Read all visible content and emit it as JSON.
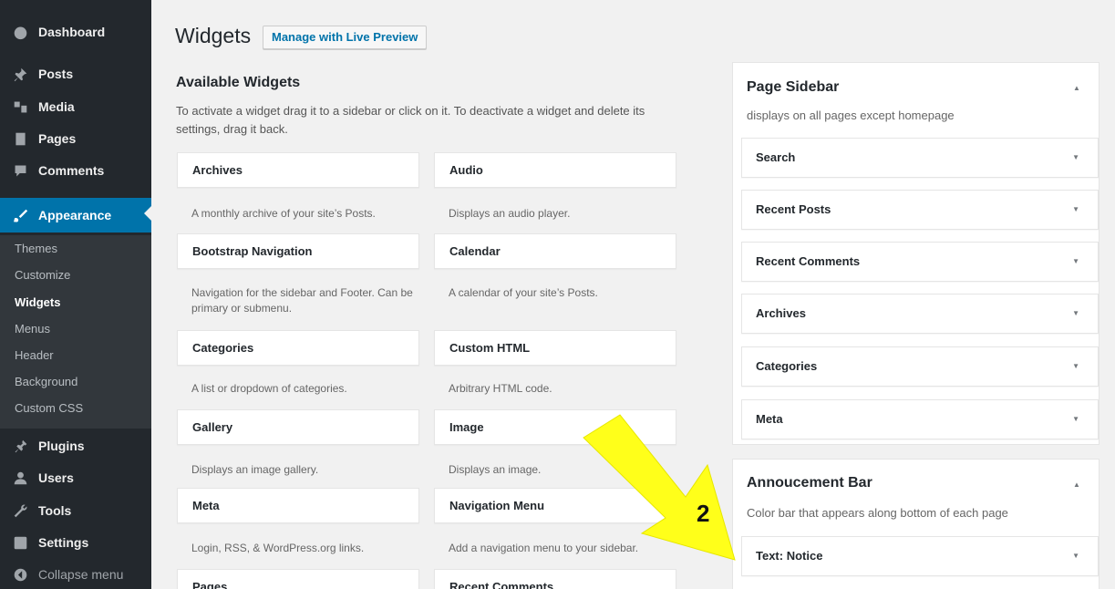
{
  "sidebar": {
    "dashboard": {
      "label": "Dashboard",
      "icon": "dashboard-icon"
    },
    "posts": {
      "label": "Posts",
      "icon": "pin-icon"
    },
    "media": {
      "label": "Media",
      "icon": "media-icon"
    },
    "pages": {
      "label": "Pages",
      "icon": "pages-icon"
    },
    "comments": {
      "label": "Comments",
      "icon": "comment-icon"
    },
    "appearance": {
      "label": "Appearance",
      "icon": "brush-icon"
    },
    "submenu": [
      "Themes",
      "Customize",
      "Widgets",
      "Menus",
      "Header",
      "Background",
      "Custom CSS"
    ],
    "plugins": {
      "label": "Plugins",
      "icon": "plug-icon"
    },
    "users": {
      "label": "Users",
      "icon": "users-icon"
    },
    "tools": {
      "label": "Tools",
      "icon": "wrench-icon"
    },
    "settings": {
      "label": "Settings",
      "icon": "settings-icon"
    },
    "collapse": {
      "label": "Collapse menu",
      "icon": "collapse-icon"
    }
  },
  "header": {
    "title": "Widgets",
    "live_preview": "Manage with Live Preview"
  },
  "available": {
    "title": "Available Widgets",
    "desc": "To activate a widget drag it to a sidebar or click on it. To deactivate a widget and delete its settings, drag it back.",
    "widgets": [
      {
        "name": "Archives",
        "desc": "A monthly archive of your site’s Posts."
      },
      {
        "name": "Audio",
        "desc": "Displays an audio player."
      },
      {
        "name": "Bootstrap Navigation",
        "desc": "Navigation for the sidebar and Footer. Can be primary or submenu."
      },
      {
        "name": "Calendar",
        "desc": "A calendar of your site’s Posts."
      },
      {
        "name": "Categories",
        "desc": "A list or dropdown of categories."
      },
      {
        "name": "Custom HTML",
        "desc": "Arbitrary HTML code."
      },
      {
        "name": "Gallery",
        "desc": "Displays an image gallery."
      },
      {
        "name": "Image",
        "desc": "Displays an image."
      },
      {
        "name": "Meta",
        "desc": "Login, RSS, & WordPress.org links."
      },
      {
        "name": "Navigation Menu",
        "desc": "Add a navigation menu to your sidebar."
      },
      {
        "name": "Pages",
        "desc": ""
      },
      {
        "name": "Recent Comments",
        "desc": ""
      }
    ]
  },
  "page_sidebar": {
    "title": "Page Sidebar",
    "desc": "displays on all pages except homepage",
    "items": [
      "Search",
      "Recent Posts",
      "Recent Comments",
      "Archives",
      "Categories",
      "Meta"
    ]
  },
  "announcement_bar": {
    "title": "Annoucement Bar",
    "desc": "Color bar that appears along bottom of each page",
    "items": [
      "Text: Notice"
    ]
  },
  "annotation": {
    "step": "2",
    "arrow_color": "#ffff1a"
  },
  "colors": {
    "admin_bg": "#23282d",
    "accent": "#0073aa",
    "submenu_bg": "#32373c"
  }
}
